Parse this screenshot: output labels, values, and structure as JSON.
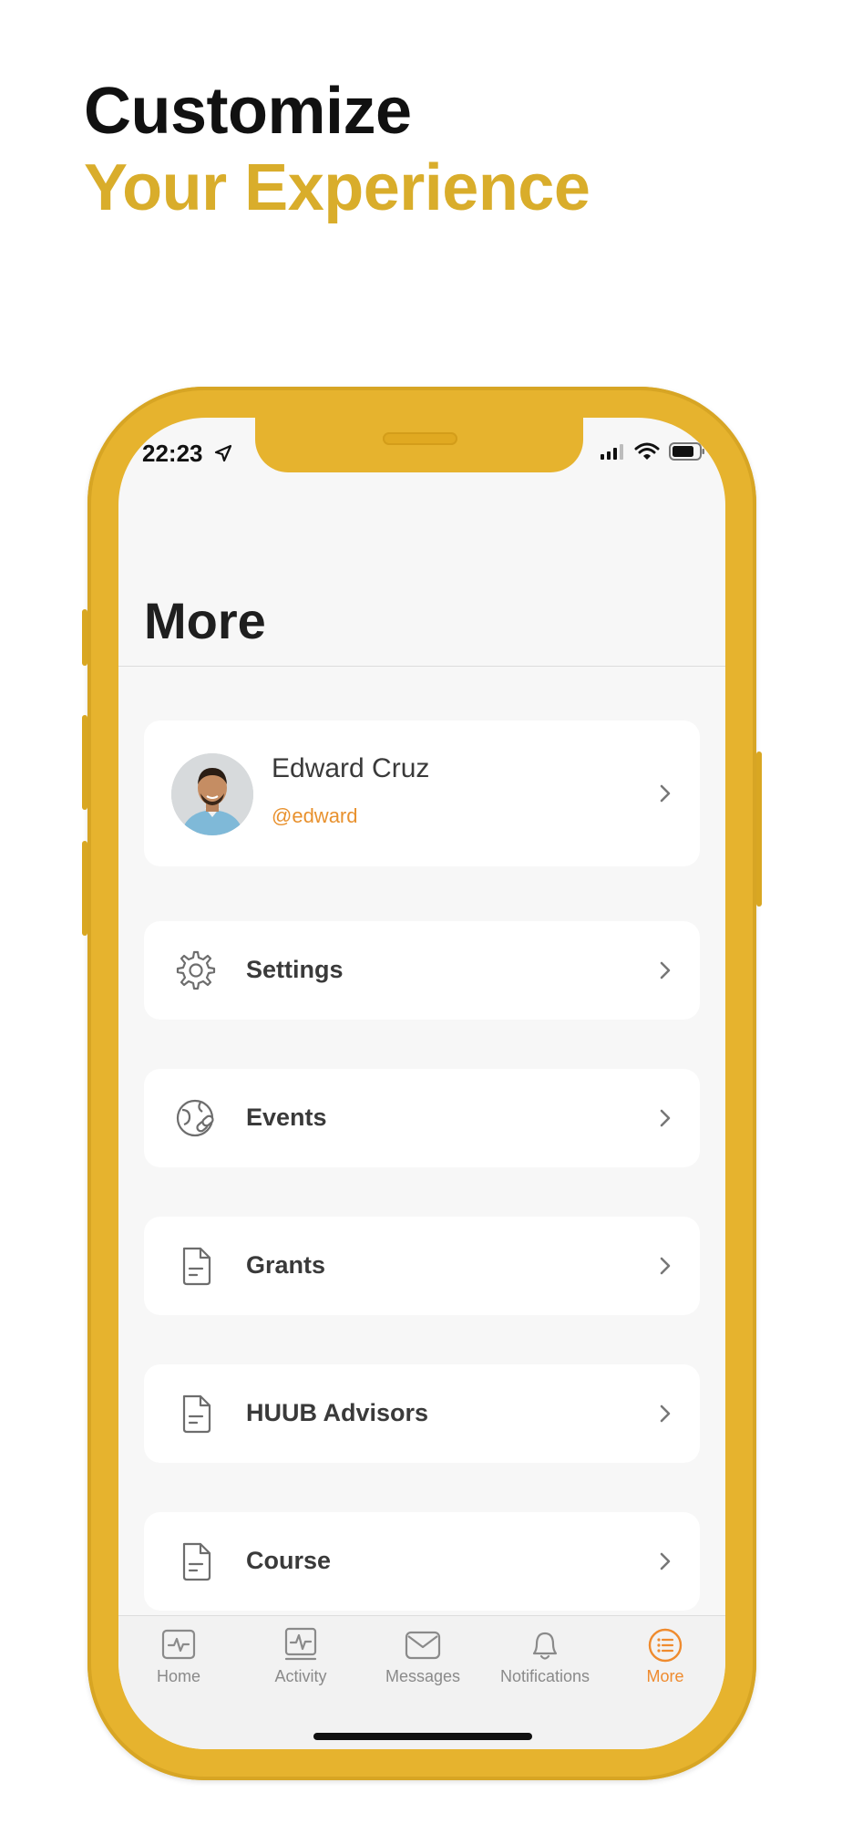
{
  "headline": {
    "line1": "Customize",
    "line2": "Your Experience"
  },
  "status_bar": {
    "time": "22:23"
  },
  "page": {
    "title": "More"
  },
  "profile": {
    "name": "Edward Cruz",
    "handle": "@edward"
  },
  "menu": [
    {
      "label": "Settings",
      "icon": "gear-icon"
    },
    {
      "label": "Events",
      "icon": "globe-link-icon"
    },
    {
      "label": "Grants",
      "icon": "document-icon"
    },
    {
      "label": "HUUB Advisors",
      "icon": "document-icon"
    },
    {
      "label": "Course",
      "icon": "document-icon"
    }
  ],
  "tabs": [
    {
      "label": "Home",
      "icon": "activity-icon",
      "active": false
    },
    {
      "label": "Activity",
      "icon": "activity-tray-icon",
      "active": false
    },
    {
      "label": "Messages",
      "icon": "envelope-icon",
      "active": false
    },
    {
      "label": "Notifications",
      "icon": "bell-icon",
      "active": false
    },
    {
      "label": "More",
      "icon": "list-icon",
      "active": true
    }
  ],
  "colors": {
    "brand_gold": "#e6b32e",
    "headline_gold": "#d9ad2b",
    "accent_orange": "#ef8b2e"
  }
}
